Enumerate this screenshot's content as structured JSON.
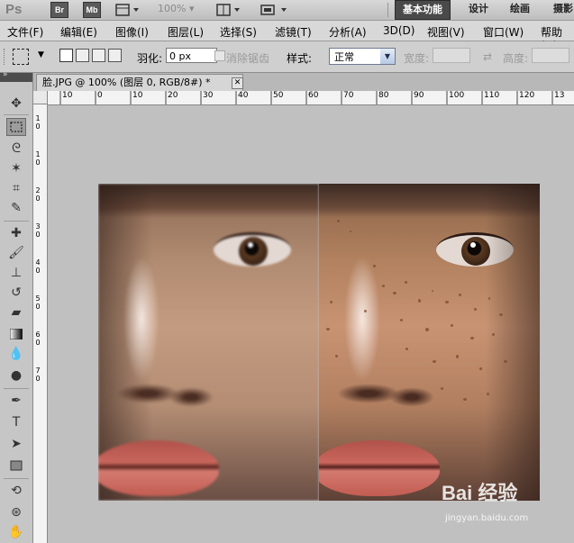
{
  "app": {
    "logo": "Ps",
    "bridge_label": "Br",
    "mini_bridge_label": "Mb",
    "zoom_level": "100%",
    "workspaces": [
      "基本功能",
      "设计",
      "绘画",
      "摄影"
    ]
  },
  "menu": [
    "文件(F)",
    "编辑(E)",
    "图像(I)",
    "图层(L)",
    "选择(S)",
    "滤镜(T)",
    "分析(A)",
    "3D(D)",
    "视图(V)",
    "窗口(W)",
    "帮助(H)"
  ],
  "options": {
    "feather_label": "羽化:",
    "feather_value": "0 px",
    "antialias_label": "消除锯齿",
    "style_label": "样式:",
    "style_value": "正常",
    "width_label": "宽度:",
    "height_label": "高度:"
  },
  "document": {
    "tab_title": "脸.JPG @ 100% (图层 0, RGB/8#) *",
    "ruler_top": [
      "10",
      "0",
      "10",
      "20",
      "30",
      "40",
      "50",
      "60",
      "70",
      "80",
      "90",
      "100",
      "110",
      "120",
      "13"
    ],
    "ruler_left": [
      "1",
      "0",
      "1",
      "0",
      "2",
      "0",
      "3",
      "0",
      "4",
      "0",
      "5",
      "0",
      "6",
      "0",
      "7",
      "0"
    ]
  },
  "tools": [
    "move-icon",
    "marquee-icon",
    "lasso-icon",
    "magic-wand-icon",
    "crop-icon",
    "eyedropper-icon",
    "healing-brush-icon",
    "brush-icon",
    "clone-stamp-icon",
    "history-brush-icon",
    "eraser-icon",
    "gradient-icon",
    "blur-icon",
    "dodge-icon",
    "pen-icon",
    "type-icon",
    "path-selection-icon",
    "rectangle-icon",
    "3d-rotate-icon",
    "3d-orbit-icon",
    "hand-icon"
  ],
  "watermark": {
    "main": "Bai 经验",
    "sub": "jingyan.baidu.com"
  }
}
